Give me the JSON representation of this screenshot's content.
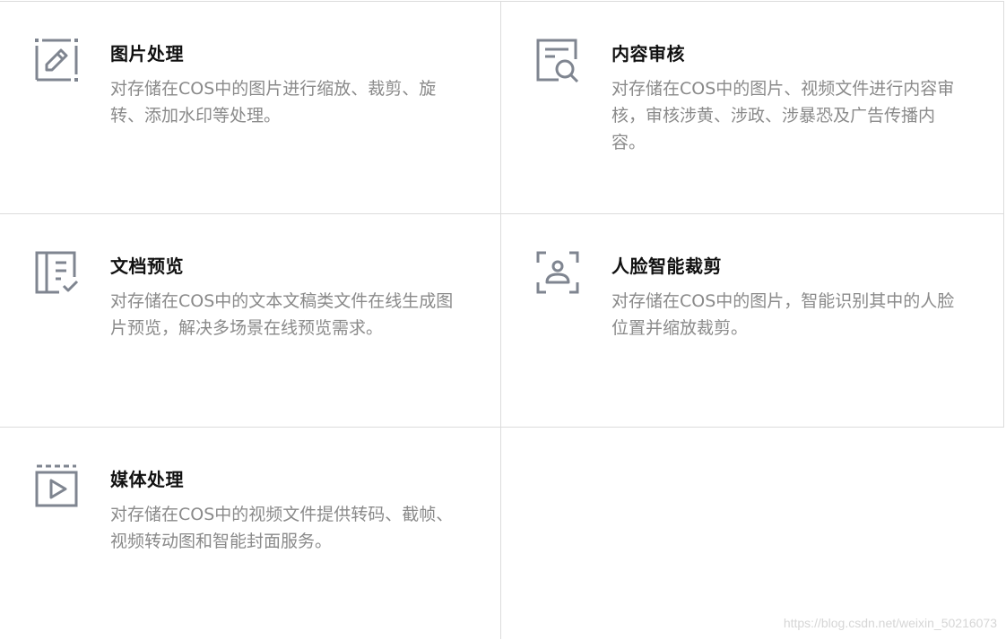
{
  "features": [
    {
      "icon": "image-edit-icon",
      "title": "图片处理",
      "description": "对存储在COS中的图片进行缩放、裁剪、旋转、添加水印等处理。"
    },
    {
      "icon": "content-search-icon",
      "title": "内容审核",
      "description": "对存储在COS中的图片、视频文件进行内容审核，审核涉黄、涉政、涉暴恐及广告传播内容。"
    },
    {
      "icon": "document-preview-icon",
      "title": "文档预览",
      "description": "对存储在COS中的文本文稿类文件在线生成图片预览，解决多场景在线预览需求。"
    },
    {
      "icon": "face-crop-icon",
      "title": "人脸智能裁剪",
      "description": "对存储在COS中的图片，智能识别其中的人脸位置并缩放裁剪。"
    },
    {
      "icon": "media-play-icon",
      "title": "媒体处理",
      "description": "对存储在COS中的视频文件提供转码、截帧、视频转动图和智能封面服务。"
    }
  ],
  "watermark": "https://blog.csdn.net/weixin_50216073",
  "colors": {
    "icon": "#7f8590",
    "border": "#dcdcdc",
    "title": "#111111",
    "description": "#8a8a8a"
  }
}
